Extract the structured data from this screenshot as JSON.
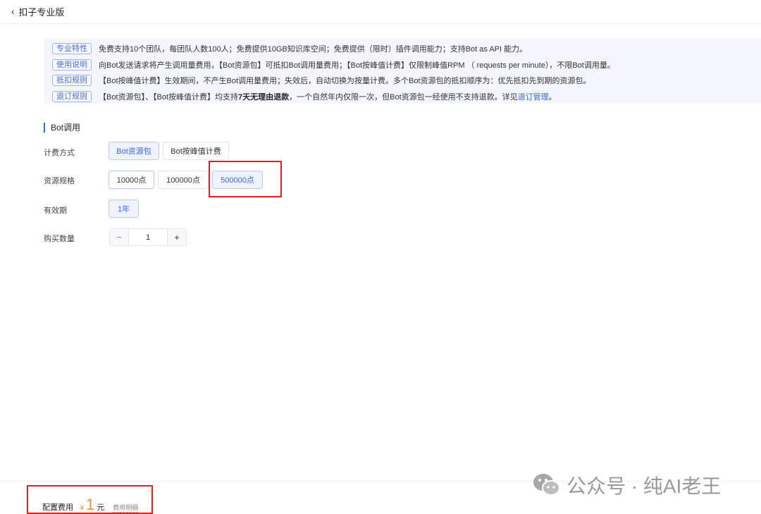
{
  "header": {
    "title": "扣子专业版"
  },
  "info": [
    {
      "tag": "专业特性",
      "text": "免费支持10个团队，每团队人数100人；免费提供10GB知识库空间；免费提供（限时）插件调用能力；支持Bot as API 能力。"
    },
    {
      "tag": "使用说明",
      "text": "向Bot发送请求将产生调用量费用，【Bot资源包】可抵扣Bot调用量费用；【Bot按峰值计费】仅限制峰值RPM （ requests per minute），不限Bot调用量。"
    },
    {
      "tag": "抵扣规则",
      "text": "【Bot按峰值计费】生效期间，不产生Bot调用量费用；失效后，自动切换为按量计费。多个Bot资源包的抵扣顺序为：优先抵扣先到期的资源包。"
    },
    {
      "tag": "退订规则",
      "text_before": "【Bot资源包】、【Bot按峰值计费】均支持",
      "text_bold": "7天无理由退款",
      "text_after": "，一个自然年内仅限一次，但Bot资源包一经使用不支持退款。详见",
      "link": "退订管理",
      "text_end": "。"
    }
  ],
  "section": {
    "title": "Bot调用"
  },
  "form": {
    "billing_label": "计费方式",
    "billing_options": [
      "Bot资源包",
      "Bot按峰值计费"
    ],
    "spec_label": "资源规格",
    "spec_options": [
      "10000点",
      "100000点",
      "500000点"
    ],
    "validity_label": "有效期",
    "validity_options": [
      "1年"
    ],
    "qty_label": "购买数量",
    "qty_value": "1",
    "minus": "−",
    "plus": "+"
  },
  "footer": {
    "label": "配置费用",
    "currency": "¥",
    "amount": "1",
    "unit": "元",
    "detail_link": "费用明细"
  },
  "watermark": {
    "text": "公众号 · 纯AI老王"
  }
}
